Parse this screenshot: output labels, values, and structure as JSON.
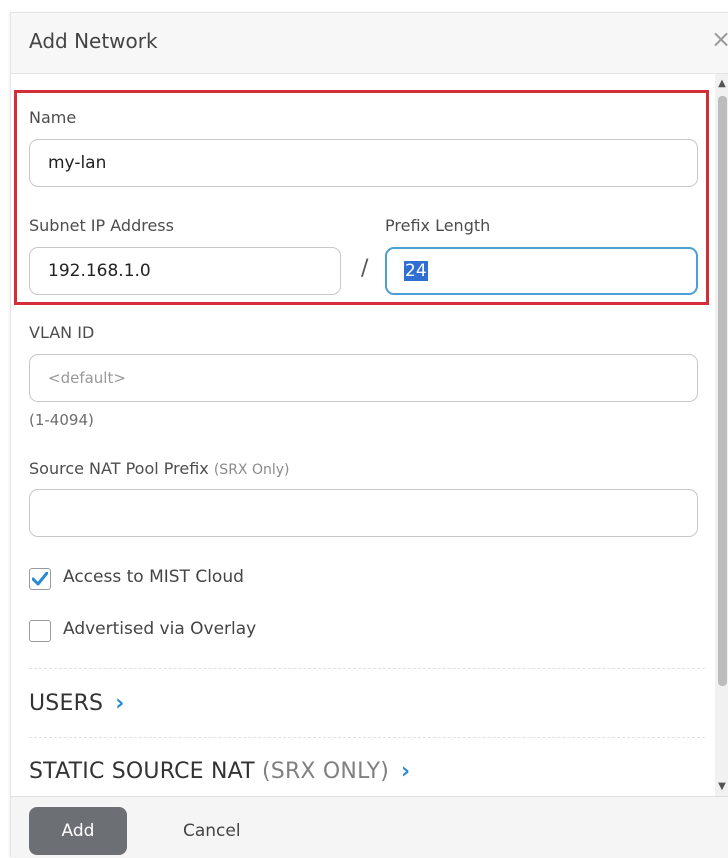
{
  "dialog": {
    "title": "Add Network",
    "close_glyph": "×"
  },
  "fields": {
    "name": {
      "label": "Name",
      "value": "my-lan"
    },
    "subnet": {
      "label": "Subnet IP Address",
      "value": "192.168.1.0"
    },
    "separator": "/",
    "prefix": {
      "label": "Prefix Length",
      "value": "24"
    },
    "vlan": {
      "label": "VLAN ID",
      "placeholder": "<default>",
      "hint": "(1-4094)"
    },
    "nat_pool": {
      "label": "Source NAT Pool Prefix",
      "aside": "(SRX Only)",
      "value": ""
    }
  },
  "checkboxes": [
    {
      "label": "Access to MIST Cloud",
      "checked": true
    },
    {
      "label": "Advertised via Overlay",
      "checked": false
    }
  ],
  "sections": {
    "users": {
      "label": "USERS",
      "chevron": "›"
    },
    "static_nat": {
      "label": "STATIC SOURCE NAT",
      "aside": "(SRX ONLY)",
      "chevron": "›"
    }
  },
  "footer": {
    "add_label": "Add",
    "cancel_label": "Cancel"
  },
  "colors": {
    "highlight_border": "#d32f3a",
    "focus_border": "#4a9fd4",
    "accent": "#2a8ad4",
    "checkbox_check": "#2a8ad4",
    "add_button": "#6c6f73"
  },
  "icons": {
    "close": "close-icon",
    "check": "checkmark-icon",
    "chevron": "chevron-right-icon"
  }
}
